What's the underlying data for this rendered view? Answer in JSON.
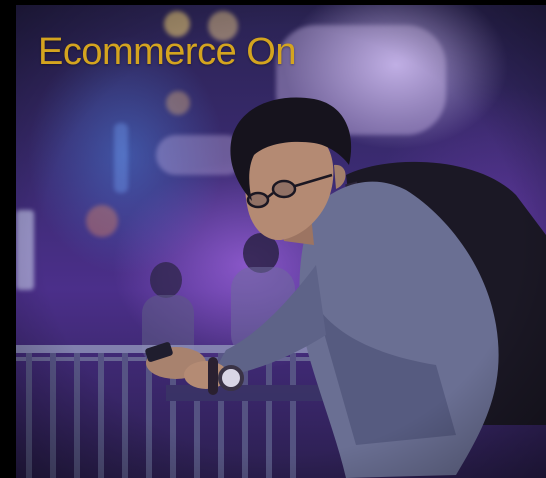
{
  "hero": {
    "headline": "Ecommerce On",
    "image": "photo-man-using-smartphone-at-night"
  },
  "colors": {
    "headline": "#d4a41f",
    "frame": "#000000",
    "ambient": "#4b2f8a"
  }
}
